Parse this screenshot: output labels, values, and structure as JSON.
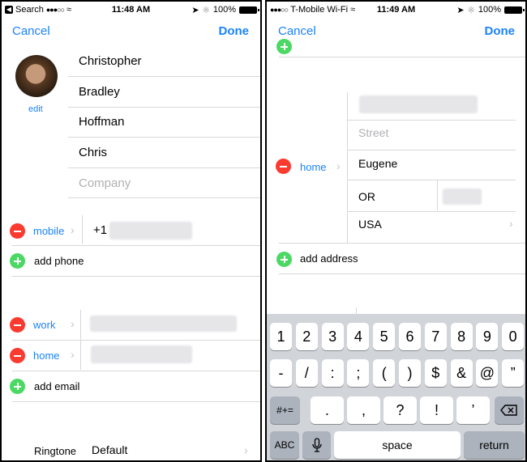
{
  "left": {
    "status": {
      "back_label": "Search",
      "time": "11:48 AM",
      "battery": "100%"
    },
    "nav": {
      "cancel": "Cancel",
      "done": "Done"
    },
    "photo": {
      "edit_label": "edit"
    },
    "name_fields": [
      {
        "value": "Christopher"
      },
      {
        "value": "Bradley"
      },
      {
        "value": "Hoffman"
      },
      {
        "value": "Chris"
      },
      {
        "placeholder": "Company"
      }
    ],
    "phones": [
      {
        "label": "mobile",
        "prefix": "+1"
      }
    ],
    "add_phone": "add phone",
    "emails": [
      {
        "label": "work"
      },
      {
        "label": "home"
      }
    ],
    "add_email": "add email",
    "ringtone": {
      "label": "Ringtone",
      "value": "Default"
    }
  },
  "right": {
    "status": {
      "carrier": "T-Mobile Wi-Fi",
      "time": "11:49 AM",
      "battery": "100%"
    },
    "nav": {
      "cancel": "Cancel",
      "done": "Done"
    },
    "address": {
      "label": "home",
      "street2_placeholder": "Street",
      "city": "Eugene",
      "state": "OR",
      "country": "USA"
    },
    "add_address": "add address",
    "keyboard": {
      "row1": [
        "1",
        "2",
        "3",
        "4",
        "5",
        "6",
        "7",
        "8",
        "9",
        "0"
      ],
      "row2": [
        "-",
        "/",
        ":",
        ";",
        "(",
        ")",
        "$",
        "&",
        "@",
        "”"
      ],
      "row3": {
        "toggle": "#+=",
        "keys": [
          ".",
          ",",
          "?",
          "!",
          "’"
        ],
        "delete": "delete-icon"
      },
      "row4": {
        "abc": "ABC",
        "mic": "microphone-icon",
        "space": "space",
        "return": "return"
      }
    }
  }
}
